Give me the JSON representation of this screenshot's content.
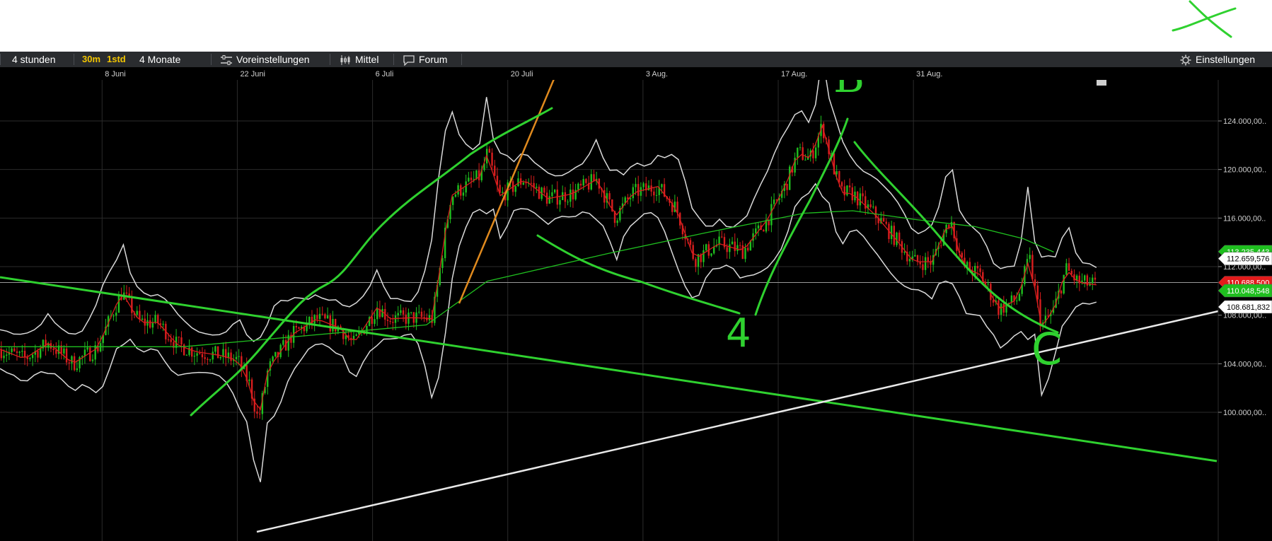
{
  "toolbar": {
    "period_label": "4 stunden",
    "interval_30m": "30m",
    "interval_1std": "1std",
    "range_label": "4 Monate",
    "presets_label": "Voreinstellungen",
    "average_label": "Mittel",
    "forum_label": "Forum",
    "settings_label": "Einstellungen",
    "icons": [
      "sliders-icon",
      "candlestick-icon",
      "chat-bubble-icon",
      "gear-icon"
    ]
  },
  "colors": {
    "background": "#000000",
    "toolbar": "#2a2c2f",
    "drawing_green": "#2fd12f",
    "trend_white": "#e8e8e8",
    "orange_line": "#e08a1e",
    "badge_yellow": "#f2c500",
    "up_candle": "#1fbf1f",
    "down_candle": "#d81e1e"
  },
  "chart_data": {
    "type": "candlestick",
    "x_tick_labels": [
      "8 Juni",
      "22 Juni",
      "6 Juli",
      "20 Juli",
      "3 Aug.",
      "17 Aug.",
      "31 Aug."
    ],
    "y_tick_labels": [
      "124.000,00..",
      "120.000,00..",
      "116.000,00..",
      "112.000,00..",
      "108.000,00..",
      "104.000,00..",
      "100.000,00.."
    ],
    "y_ticks": [
      124000,
      120000,
      116000,
      112000,
      108000,
      104000,
      100000
    ],
    "ylim": [
      98000,
      125500
    ],
    "grid": true,
    "price_path": [
      [
        0,
        105200
      ],
      [
        0.02,
        104400
      ],
      [
        0.04,
        105700
      ],
      [
        0.06,
        104000
      ],
      [
        0.08,
        105300
      ],
      [
        0.1,
        109900
      ],
      [
        0.115,
        107400
      ],
      [
        0.13,
        107400
      ],
      [
        0.145,
        105600
      ],
      [
        0.16,
        105000
      ],
      [
        0.18,
        104700
      ],
      [
        0.195,
        104300
      ],
      [
        0.205,
        102300
      ],
      [
        0.212,
        99300
      ],
      [
        0.22,
        103500
      ],
      [
        0.24,
        106400
      ],
      [
        0.26,
        107700
      ],
      [
        0.28,
        106900
      ],
      [
        0.29,
        105600
      ],
      [
        0.31,
        108700
      ],
      [
        0.32,
        107700
      ],
      [
        0.34,
        107800
      ],
      [
        0.355,
        107700
      ],
      [
        0.37,
        117800
      ],
      [
        0.38,
        118500
      ],
      [
        0.395,
        119500
      ],
      [
        0.4,
        121400
      ],
      [
        0.41,
        117800
      ],
      [
        0.43,
        119200
      ],
      [
        0.45,
        117600
      ],
      [
        0.47,
        118000
      ],
      [
        0.49,
        119200
      ],
      [
        0.505,
        116100
      ],
      [
        0.52,
        118100
      ],
      [
        0.54,
        118600
      ],
      [
        0.555,
        116800
      ],
      [
        0.57,
        112600
      ],
      [
        0.59,
        113900
      ],
      [
        0.61,
        113300
      ],
      [
        0.63,
        115900
      ],
      [
        0.645,
        118700
      ],
      [
        0.655,
        121400
      ],
      [
        0.665,
        120900
      ],
      [
        0.675,
        123600
      ],
      [
        0.69,
        118100
      ],
      [
        0.7,
        118000
      ],
      [
        0.72,
        116100
      ],
      [
        0.735,
        114300
      ],
      [
        0.75,
        112400
      ],
      [
        0.765,
        112400
      ],
      [
        0.78,
        116000
      ],
      [
        0.79,
        112100
      ],
      [
        0.805,
        111300
      ],
      [
        0.82,
        108500
      ],
      [
        0.835,
        109300
      ],
      [
        0.845,
        112700
      ],
      [
        0.855,
        107100
      ],
      [
        0.865,
        108400
      ],
      [
        0.875,
        111800
      ],
      [
        0.885,
        110700
      ],
      [
        0.9,
        110500
      ]
    ],
    "bollinger_half_width": 2300,
    "ma_slow": [
      [
        0,
        105400
      ],
      [
        0.15,
        105400
      ],
      [
        0.25,
        106300
      ],
      [
        0.35,
        107200
      ],
      [
        0.4,
        110800
      ],
      [
        0.5,
        113100
      ],
      [
        0.58,
        114800
      ],
      [
        0.62,
        115600
      ],
      [
        0.66,
        116400
      ],
      [
        0.7,
        116600
      ],
      [
        0.75,
        115900
      ],
      [
        0.8,
        115300
      ],
      [
        0.84,
        114300
      ],
      [
        0.865,
        113200
      ]
    ],
    "price_labels": [
      {
        "text": "113.235,443",
        "value": 113235,
        "color": "#1fbf1f",
        "text_color": "#ffffff"
      },
      {
        "text": "112.659,576",
        "value": 112660,
        "color": "#ffffff",
        "text_color": "#000000"
      },
      {
        "text": "110.688,500",
        "value": 110688,
        "color": "#e31b1b",
        "text_color": "#ffffff"
      },
      {
        "text": "110.048,548",
        "value": 110020,
        "color": "#1fbf1f",
        "text_color": "#ffffff"
      },
      {
        "text": "108.681,832",
        "value": 108682,
        "color": "#ffffff",
        "text_color": "#000000"
      }
    ],
    "reference_level": 110688,
    "annotations": [
      "B",
      "4",
      "C"
    ]
  }
}
